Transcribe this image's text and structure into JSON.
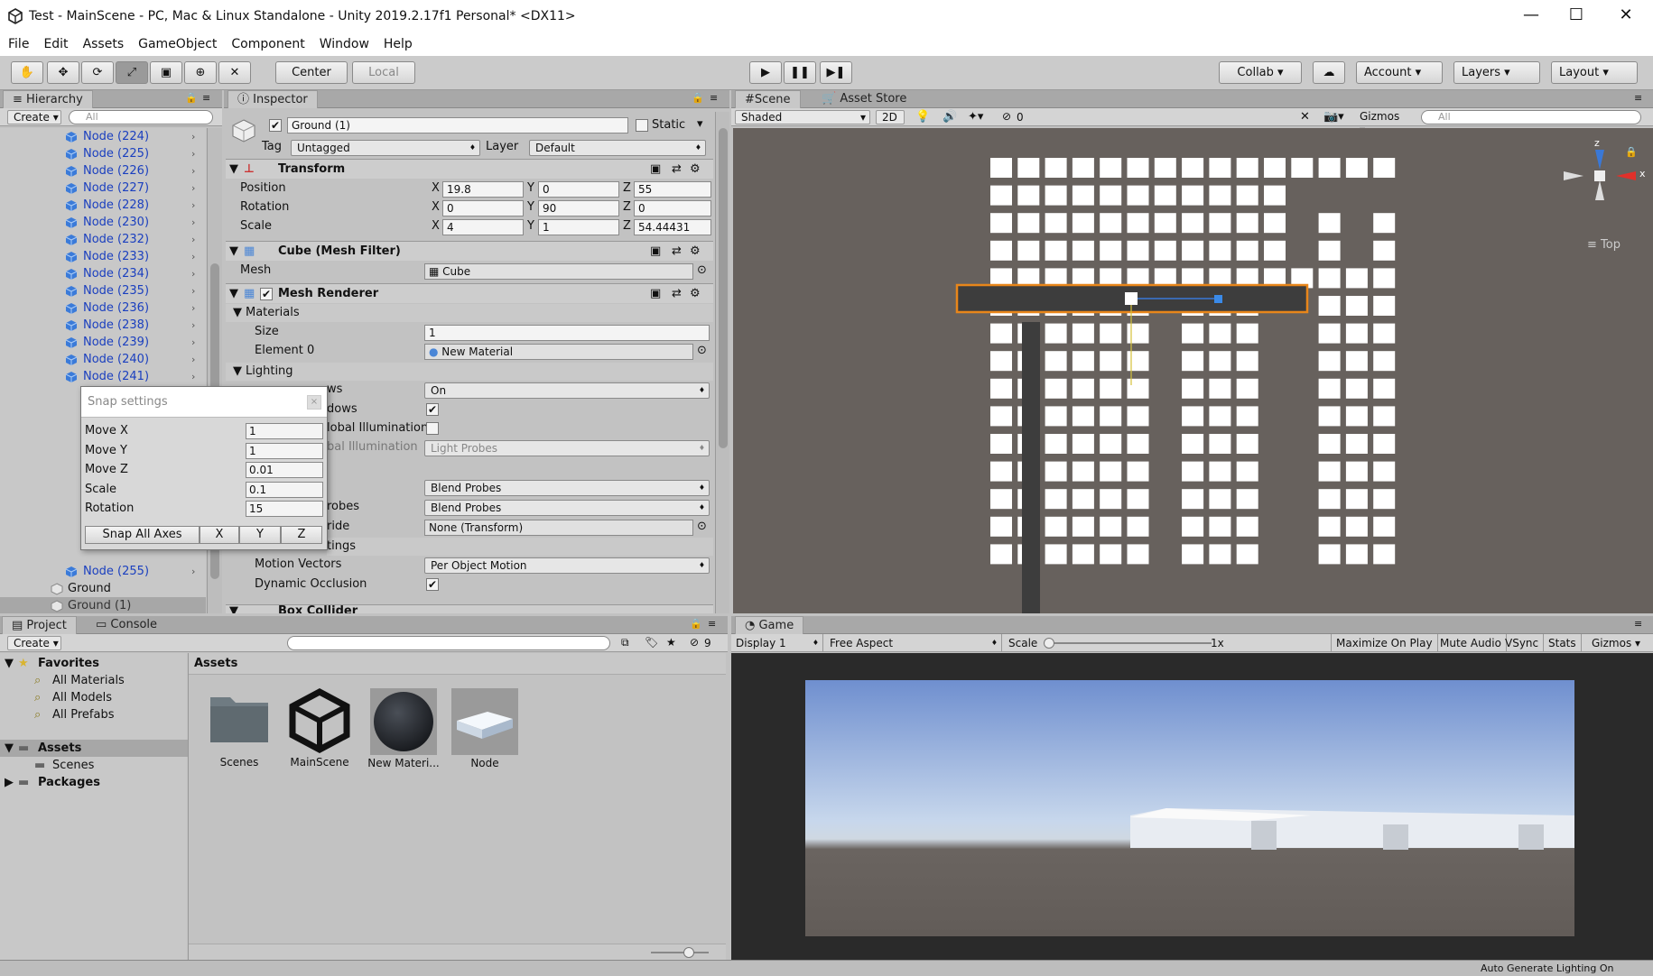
{
  "window": {
    "title": "Test - MainScene - PC, Mac & Linux Standalone - Unity 2019.2.17f1 Personal* <DX11>"
  },
  "menu": [
    "File",
    "Edit",
    "Assets",
    "GameObject",
    "Component",
    "Window",
    "Help"
  ],
  "toolbar": {
    "pivot_center": "Center",
    "pivot_local": "Local",
    "collab": "Collab",
    "account": "Account",
    "layers": "Layers",
    "layout": "Layout"
  },
  "hierarchy": {
    "tab": "Hierarchy",
    "create": "Create",
    "search_placeholder": "All",
    "items": [
      "Node (224)",
      "Node (225)",
      "Node (226)",
      "Node (227)",
      "Node (228)",
      "Node (230)",
      "Node (232)",
      "Node (233)",
      "Node (234)",
      "Node (235)",
      "Node (236)",
      "Node (238)",
      "Node (239)",
      "Node (240)",
      "Node (241)"
    ],
    "item_bottom": "Node (255)",
    "ground": "Ground",
    "ground1": "Ground (1)"
  },
  "inspector": {
    "tab": "Inspector",
    "object_name": "Ground (1)",
    "static_label": "Static",
    "tag_label": "Tag",
    "tag_value": "Untagged",
    "layer_label": "Layer",
    "layer_value": "Default",
    "transform": {
      "title": "Transform",
      "position_label": "Position",
      "rotation_label": "Rotation",
      "scale_label": "Scale",
      "axis_x": "X",
      "axis_y": "Y",
      "axis_z": "Z",
      "position": [
        "19.8",
        "0",
        "55"
      ],
      "rotation": [
        "0",
        "90",
        "0"
      ],
      "scale": [
        "4",
        "1",
        "54.44431"
      ]
    },
    "mesh_filter": {
      "title": "Cube (Mesh Filter)",
      "mesh_label": "Mesh",
      "mesh_value": "Cube"
    },
    "mesh_renderer": {
      "title": "Mesh Renderer",
      "materials": "Materials",
      "size_label": "Size",
      "size_value": "1",
      "element0_label": "Element 0",
      "element0_value": "New Material",
      "lighting": "Lighting",
      "cast_shadows_partial": "ws",
      "cast_shadows_value": "On",
      "receive_shadows_partial": "dows",
      "gi_partial": "lobal Illumination",
      "receive_gi_partial": "bal Illumination",
      "receive_gi_value": "Light Probes",
      "light_probes_value": "Blend Probes",
      "reflection_probes_partial": "robes",
      "reflection_probes_value": "Blend Probes",
      "anchor_partial": "ride",
      "anchor_value": "None (Transform)",
      "settings_partial": "tings",
      "motion_vectors_label": "Motion Vectors",
      "motion_vectors_value": "Per Object Motion",
      "dynamic_occlusion_label": "Dynamic Occlusion"
    },
    "next_component": "Box Collider"
  },
  "snap": {
    "title": "Snap settings",
    "rows": [
      {
        "label": "Move X",
        "value": "1"
      },
      {
        "label": "Move Y",
        "value": "1"
      },
      {
        "label": "Move Z",
        "value": "0.01"
      },
      {
        "label": "Scale",
        "value": "0.1"
      },
      {
        "label": "Rotation",
        "value": "15"
      }
    ],
    "snap_all": "Snap All Axes",
    "x": "X",
    "y": "Y",
    "z": "Z"
  },
  "scene": {
    "tab_scene": "Scene",
    "tab_store": "Asset Store",
    "shading": "Shaded",
    "mode_2d": "2D",
    "hidden_count": "0",
    "gizmos": "Gizmos",
    "search_placeholder": "All",
    "view_label": "Top",
    "axis_z": "z",
    "axis_x": "x"
  },
  "project": {
    "tab_project": "Project",
    "tab_console": "Console",
    "create": "Create",
    "hidden_count": "9",
    "favorites": "Favorites",
    "fav_items": [
      "All Materials",
      "All Models",
      "All Prefabs"
    ],
    "assets_root": "Assets",
    "scenes": "Scenes",
    "packages": "Packages",
    "assets_header": "Assets",
    "assets": [
      "Scenes",
      "MainScene",
      "New Materi...",
      "Node"
    ]
  },
  "game": {
    "tab": "Game",
    "display": "Display 1",
    "aspect": "Free Aspect",
    "scale_label": "Scale",
    "scale_value": "1x",
    "maximize": "Maximize On Play",
    "mute": "Mute Audio",
    "vsync": "VSync",
    "stats": "Stats",
    "gizmos": "Gizmos"
  },
  "status": "Auto Generate Lighting On"
}
